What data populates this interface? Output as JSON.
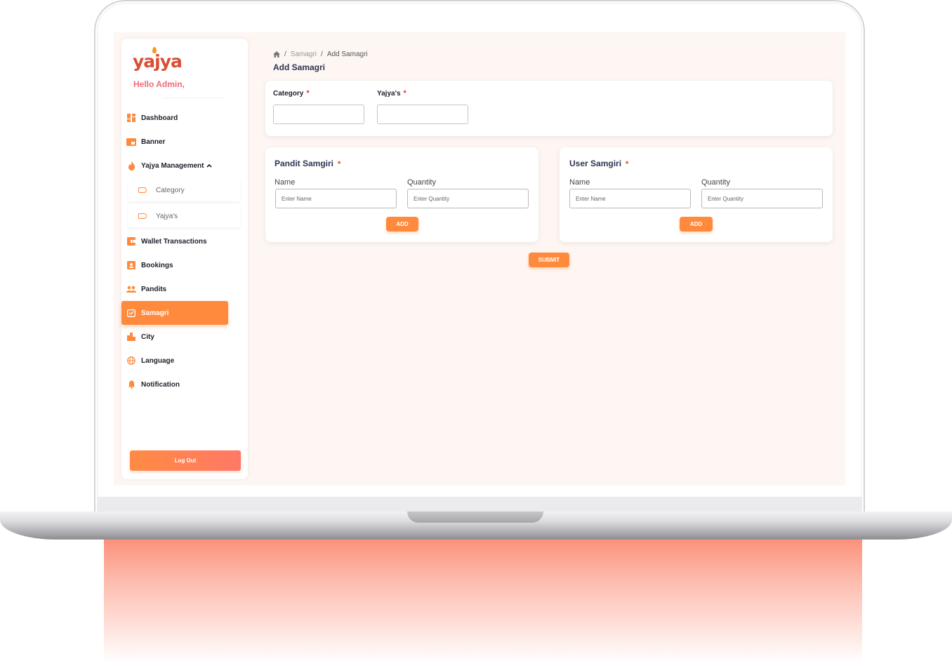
{
  "brand": {
    "logo_text": "yajya",
    "greeting": "Hello Admin,"
  },
  "sidebar": {
    "items": [
      {
        "label": "Dashboard",
        "icon": "dashboard-icon"
      },
      {
        "label": "Banner",
        "icon": "banner-icon"
      },
      {
        "label": "Yajya Management",
        "icon": "flame-icon",
        "expanded": true
      },
      {
        "label": "Wallet Transactions",
        "icon": "wallet-icon"
      },
      {
        "label": "Bookings",
        "icon": "bookings-icon"
      },
      {
        "label": "Pandits",
        "icon": "people-icon"
      },
      {
        "label": "Samagri",
        "icon": "samagri-icon",
        "active": true
      },
      {
        "label": "City",
        "icon": "city-icon"
      },
      {
        "label": "Language",
        "icon": "globe-icon"
      },
      {
        "label": "Notification",
        "icon": "bell-icon"
      }
    ],
    "sub_items": [
      {
        "label": "Category"
      },
      {
        "label": "Yajya's"
      }
    ],
    "logout_label": "Log Out"
  },
  "breadcrumb": {
    "items": [
      "Samagri",
      "Add Samagri"
    ]
  },
  "page_title": "Add Samagri",
  "selection": {
    "category_label": "Category",
    "yajya_label": "Yajya's",
    "required_mark": "*"
  },
  "pandit_card": {
    "title": "Pandit Samgiri",
    "name_label": "Name",
    "quantity_label": "Quantity",
    "name_placeholder": "Enter Name",
    "quantity_placeholder": "Enter Quantity",
    "add_label": "ADD"
  },
  "user_card": {
    "title": "User Samgiri",
    "name_label": "Name",
    "quantity_label": "Quantity",
    "name_placeholder": "Enter Name",
    "quantity_placeholder": "Enter Quantity",
    "add_label": "ADD"
  },
  "submit_label": "SUBMIT",
  "colors": {
    "accent": "#ff8a3d",
    "brand_red": "#d94f34",
    "greeting_pink": "#ef6a76",
    "required": "#e53935",
    "page_bg": "#fdf6f2"
  }
}
